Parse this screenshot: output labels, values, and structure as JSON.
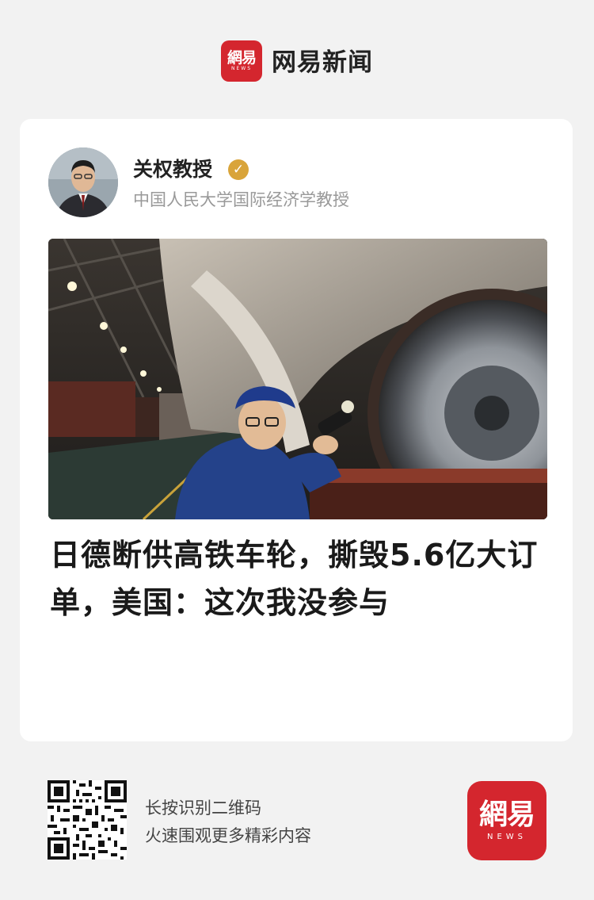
{
  "header": {
    "logo_text": "網易",
    "logo_subtext": "NEWS",
    "app_name": "网易新闻",
    "icon": "netease-news-logo-icon"
  },
  "post": {
    "author_name": "关权教授",
    "verified_icon": "verified-badge-icon",
    "verified_mark": "✓",
    "author_title": "中国人民大学国际经济学教授",
    "avatar_icon": "author-avatar",
    "image": "hero-photo-train-wheel-inspection",
    "headline": "日德断供高铁车轮，撕毁5.6亿大订单，美国：这次我没参与"
  },
  "footer": {
    "qr_icon": "qr-code-icon",
    "line1": "长按识别二维码",
    "line2": "火速围观更多精彩内容",
    "logo_text": "網易",
    "logo_subtext": "NEWS"
  },
  "colors": {
    "brand_red": "#d4262e",
    "verified_gold": "#d9a43a",
    "background": "#f2f2f2",
    "card": "#ffffff",
    "muted_text": "#999999"
  }
}
